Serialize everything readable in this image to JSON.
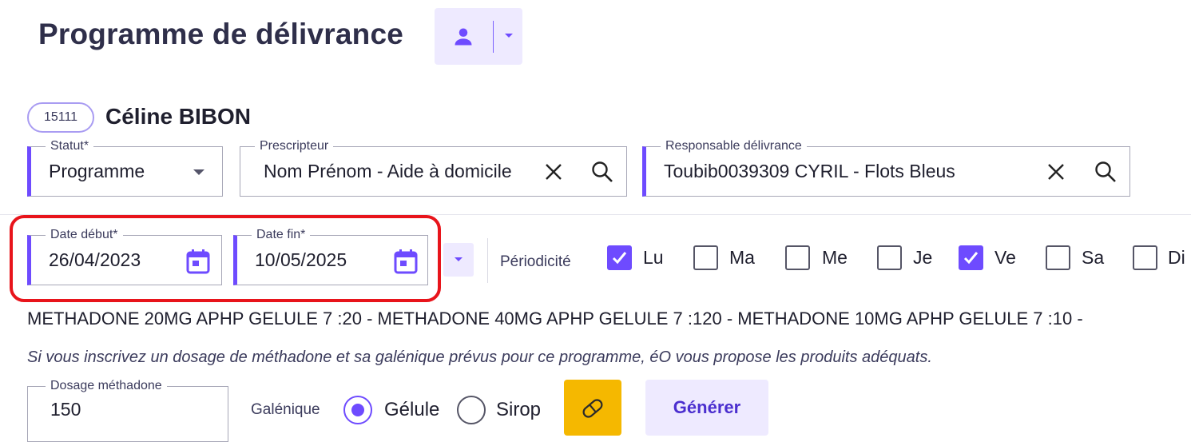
{
  "page": {
    "title": "Programme de délivrance"
  },
  "header": {
    "user_icon": "person-icon",
    "caret_icon": "chevron-down-icon"
  },
  "patient": {
    "id": "15111",
    "name": "Céline BIBON"
  },
  "form": {
    "statut": {
      "label": "Statut",
      "required_mark": "*",
      "value": "Programme"
    },
    "prescripteur": {
      "label": "Prescripteur",
      "value": "Nom Prénom - Aide à domicile"
    },
    "responsable": {
      "label": "Responsable délivrance",
      "value": "Toubib0039309 CYRIL - Flots Bleus"
    },
    "date_debut": {
      "label": "Date début",
      "required_mark": "*",
      "value": "26/04/2023"
    },
    "date_fin": {
      "label": "Date fin",
      "required_mark": "*",
      "value": "10/05/2025"
    },
    "periodicite": {
      "label": "Périodicité",
      "days": [
        {
          "label": "Lu",
          "checked": true
        },
        {
          "label": "Ma",
          "checked": false
        },
        {
          "label": "Me",
          "checked": false
        },
        {
          "label": "Je",
          "checked": false
        },
        {
          "label": "Ve",
          "checked": true
        },
        {
          "label": "Sa",
          "checked": false
        },
        {
          "label": "Di",
          "checked": false
        }
      ]
    },
    "meds_summary": "METHADONE 20MG APHP GELULE 7 :20 - METHADONE 40MG APHP GELULE 7 :120 - METHADONE 10MG APHP GELULE 7 :10 -",
    "hint": "Si vous inscrivez un dosage de méthadone et sa galénique prévus pour ce programme, éO vous propose les produits adéquats.",
    "dosage": {
      "label": "Dosage méthadone",
      "value": "150"
    },
    "galenique": {
      "label": "Galénique",
      "options": [
        {
          "label": "Gélule",
          "selected": true
        },
        {
          "label": "Sirop",
          "selected": false
        }
      ]
    },
    "generate_label": "Générer"
  },
  "colors": {
    "accent": "#6e4bff",
    "highlight": "#e8141b",
    "pill_button": "#f5b800",
    "soft_accent_bg": "#eeeaff"
  }
}
